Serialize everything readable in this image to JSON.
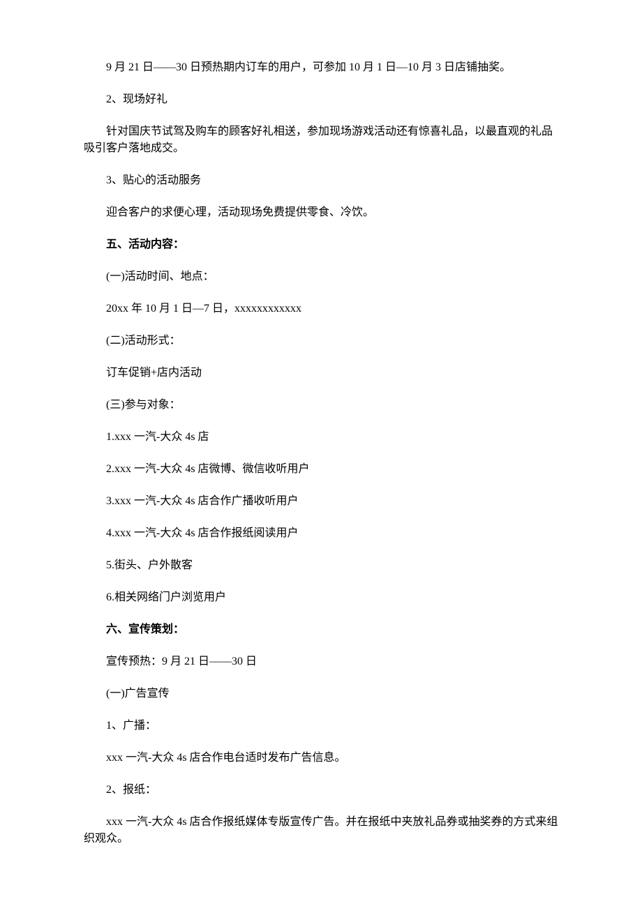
{
  "paragraphs": [
    {
      "text": "9 月 21 日——30 日预热期内订车的用户，可参加 10 月 1 日—10 月 3 日店铺抽奖。",
      "bold": false
    },
    {
      "text": "2、现场好礼",
      "bold": false
    },
    {
      "text": "针对国庆节试驾及购车的顾客好礼相送，参加现场游戏活动还有惊喜礼品，以最直观的礼品吸引客户落地成交。",
      "bold": false
    },
    {
      "text": "3、贴心的活动服务",
      "bold": false
    },
    {
      "text": "迎合客户的求便心理，活动现场免费提供零食、冷饮。",
      "bold": false
    },
    {
      "text": "五、活动内容：",
      "bold": true
    },
    {
      "text": "(一)活动时间、地点：",
      "bold": false
    },
    {
      "text": "20xx 年 10 月 1 日—7 日，xxxxxxxxxxxx",
      "bold": false
    },
    {
      "text": "(二)活动形式：",
      "bold": false
    },
    {
      "text": "订车促销+店内活动",
      "bold": false
    },
    {
      "text": "(三)参与对象：",
      "bold": false
    },
    {
      "text": "1.xxx 一汽-大众 4s 店",
      "bold": false
    },
    {
      "text": "2.xxx 一汽-大众 4s 店微博、微信收听用户",
      "bold": false
    },
    {
      "text": "3.xxx 一汽-大众 4s 店合作广播收听用户",
      "bold": false
    },
    {
      "text": "4.xxx 一汽-大众 4s 店合作报纸阅读用户",
      "bold": false
    },
    {
      "text": "5.街头、户外散客",
      "bold": false
    },
    {
      "text": "6.相关网络门户浏览用户",
      "bold": false
    },
    {
      "text": "六、宣传策划：",
      "bold": true
    },
    {
      "text": "宣传预热：9 月 21 日——30 日",
      "bold": false
    },
    {
      "text": "(一)广告宣传",
      "bold": false
    },
    {
      "text": "1、广播：",
      "bold": false
    },
    {
      "text": "xxx 一汽-大众 4s 店合作电台适时发布广告信息。",
      "bold": false
    },
    {
      "text": "2、报纸：",
      "bold": false
    },
    {
      "text": "xxx 一汽-大众 4s 店合作报纸媒体专版宣传广告。并在报纸中夹放礼品券或抽奖券的方式来组织观众。",
      "bold": false
    }
  ]
}
